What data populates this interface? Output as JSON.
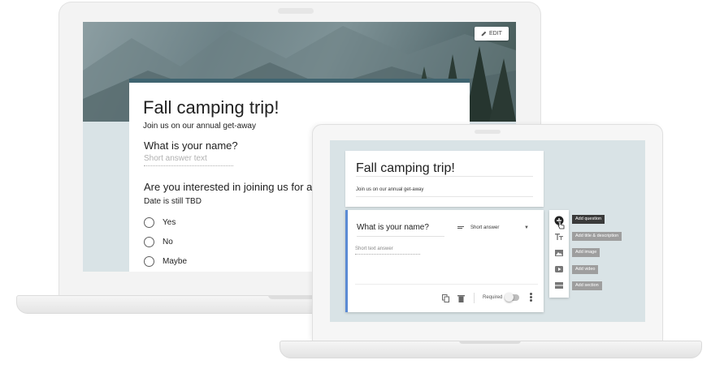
{
  "back_form": {
    "edit_label": "EDIT",
    "title": "Fall camping trip!",
    "description": "Join us on our annual get-away",
    "question1": "What is your name?",
    "answer_placeholder": "Short answer text",
    "question2": "Are you interested in joining us for a",
    "question2_sub": "Date is still TBD",
    "options": [
      "Yes",
      "No",
      "Maybe"
    ],
    "accent_color": "#3f6470"
  },
  "front_form": {
    "title": "Fall camping trip!",
    "description": "Join us on our annual get-away",
    "question": "What is your name?",
    "question_type": "Short answer",
    "answer_placeholder": "Short text answer",
    "required_label": "Required",
    "accent_color": "#5b8bd4"
  },
  "toolbar": {
    "tooltips": {
      "add_question": "Add question",
      "add_title": "Add title & description",
      "add_image": "Add image",
      "add_video": "Add video",
      "add_section": "Add section"
    },
    "icons": [
      "add-circle-icon",
      "title-icon",
      "image-icon",
      "video-icon",
      "section-icon"
    ]
  }
}
